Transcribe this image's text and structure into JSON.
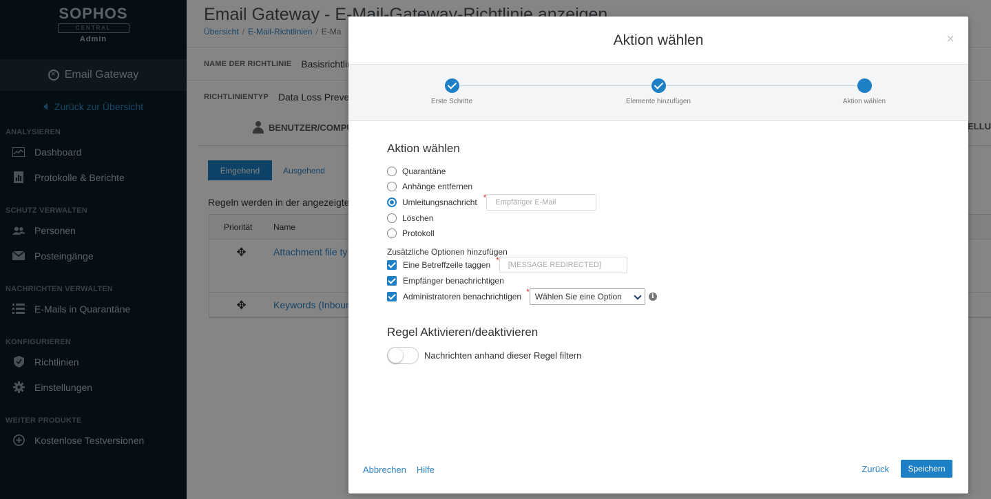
{
  "sidebar": {
    "logo": "SOPHOS",
    "logo_sub": "CENTRAL",
    "logo_admin": "Admin",
    "product": "Email Gateway",
    "back_link": "Zurück zur Übersicht",
    "sections": [
      {
        "title": "ANALYSIEREN",
        "items": [
          {
            "label": "Dashboard",
            "icon": "dashboard-icon"
          },
          {
            "label": "Protokolle & Berichte",
            "icon": "reports-icon"
          }
        ]
      },
      {
        "title": "SCHUTZ VERWALTEN",
        "items": [
          {
            "label": "Personen",
            "icon": "people-icon"
          },
          {
            "label": "Posteingänge",
            "icon": "mailbox-icon"
          }
        ]
      },
      {
        "title": "NACHRICHTEN VERWALTEN",
        "items": [
          {
            "label": "E-Mails in Quarantäne",
            "icon": "list-icon"
          }
        ]
      },
      {
        "title": "KONFIGURIEREN",
        "items": [
          {
            "label": "Richtlinien",
            "icon": "shield-icon"
          },
          {
            "label": "Einstellungen",
            "icon": "gear-icon"
          }
        ]
      },
      {
        "title": "WEITER PRODUKTE",
        "items": [
          {
            "label": "Kostenlose Testversionen",
            "icon": "plus-circle-icon"
          }
        ]
      }
    ]
  },
  "page": {
    "title": "Email Gateway - E-Mail-Gateway-Richtlinie anzeigen",
    "breadcrumb": [
      "Übersicht",
      "E-Mail-Richtlinien",
      "E-Ma"
    ],
    "policy_name_label": "NAME DER RICHTLINIE",
    "policy_name_value": "Basisrichtlinie",
    "policy_type_label": "RICHTLINIENTYP",
    "policy_type_value": "Data Loss Prevention",
    "tab_users": "BENUTZER/COMPUTER",
    "tab_right": "TELLU",
    "seg_incoming": "Eingehend",
    "seg_outgoing": "Ausgehend",
    "rules_info": "Regeln werden in der angezeigten",
    "table_headers": [
      "Priorität",
      "Name"
    ],
    "rows": [
      "Attachment file ty",
      "Keywords (Inboun"
    ],
    "drag_glyph": "✥"
  },
  "modal": {
    "title": "Aktion wählen",
    "close": "×",
    "steps": [
      "Erste Schritte",
      "Elemente hinzufügen",
      "Aktion wählen"
    ],
    "section_title": "Aktion wählen",
    "actions": [
      {
        "label": "Quarantäne",
        "selected": false
      },
      {
        "label": "Anhänge entfernen",
        "selected": false
      },
      {
        "label": "Umleitungsnachricht",
        "selected": true
      },
      {
        "label": "Löschen",
        "selected": false
      },
      {
        "label": "Protokoll",
        "selected": false
      }
    ],
    "redirect_placeholder": "Empfänger E-Mail",
    "extra_title": "Zusätzliche Optionen hinzufügen",
    "opt_tag": "Eine Betreffzeile taggen",
    "opt_tag_value": "[MESSAGE REDIRECTED]",
    "opt_notify_recipient": "Empfänger benachrichtigen",
    "opt_notify_admin": "Administratoren benachrichtigen",
    "admin_select": "Wählen Sie eine Option",
    "required_mark": "*",
    "rule_title": "Regel Aktivieren/deaktivieren",
    "toggle_label": "Nachrichten anhand dieser Regel filtern",
    "cancel": "Abbrechen",
    "help": "Hilfe",
    "back": "Zurück",
    "save": "Speichern"
  },
  "colors": {
    "accent": "#1d7fc6",
    "sidebar": "#0a1c26"
  }
}
